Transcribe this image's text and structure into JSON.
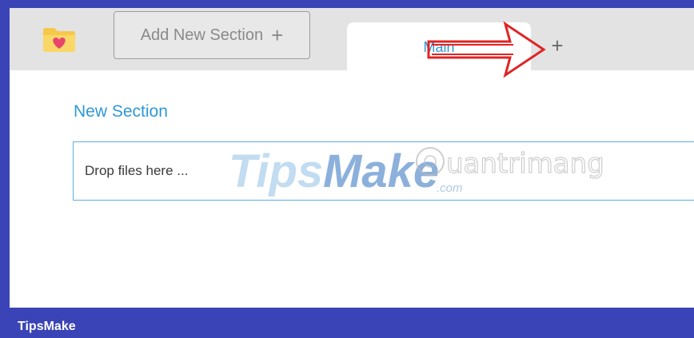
{
  "tabbar": {
    "add_section_label": "Add New Section",
    "add_section_icon": "plus-icon",
    "active_tab_label": "Main",
    "new_tab_icon": "plus-icon",
    "app_icon": "heart-folder-icon"
  },
  "content": {
    "section_title": "New Section",
    "drop_zone_label": "Drop files here ..."
  },
  "watermark": {
    "brand_a": "Tips",
    "brand_b": "Make",
    "brand_suffix": ".com",
    "brand_c": "uantrimang"
  },
  "footer": {
    "brand": "TipsMake"
  },
  "colors": {
    "accent": "#2f98d6",
    "frame": "#3b44b6",
    "annotation": "#e02424"
  }
}
